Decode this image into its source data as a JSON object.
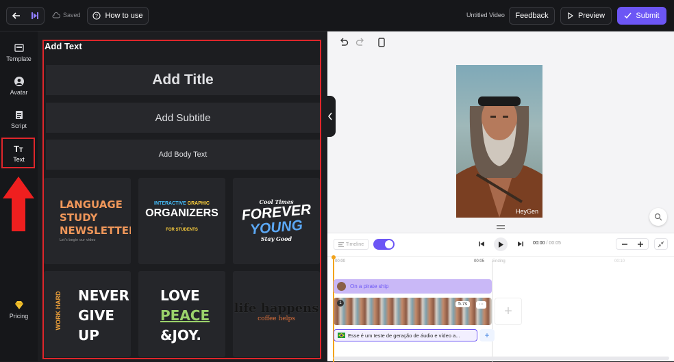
{
  "header": {
    "saved_label": "Saved",
    "how_to_use_label": "How to use",
    "project_title": "Untitled Video",
    "feedback_label": "Feedback",
    "preview_label": "Preview",
    "submit_label": "Submit",
    "submit_color": "#6c56f5"
  },
  "sidebar": {
    "items": [
      {
        "label": "Template",
        "icon": "template-icon"
      },
      {
        "label": "Avatar",
        "icon": "avatar-icon"
      },
      {
        "label": "Script",
        "icon": "script-icon"
      },
      {
        "label": "Text",
        "icon": "text-icon",
        "selected": true
      },
      {
        "label": "Pricing",
        "icon": "gem-icon"
      }
    ]
  },
  "panel": {
    "title": "Add Text",
    "add_title": "Add Title",
    "add_subtitle": "Add Subtitle",
    "add_body": "Add Body Text",
    "tiles": [
      {
        "lines": [
          "LANGUAGE",
          "STUDY",
          "NEWSLETTER"
        ],
        "sub": "Let's begin our video"
      },
      {
        "top": [
          "INTERACTIVE",
          "GRAPHIC"
        ],
        "main": "ORGANIZERS",
        "dash": "-",
        "bottom": "FOR STUDENTS"
      },
      {
        "top": "Cool Times",
        "main1": "FOREVER",
        "main2": "YOUNG",
        "bottom": "Stay Good"
      },
      {
        "side": "WORK HARD",
        "lines": [
          "NEVER",
          "GIVE",
          "UP"
        ]
      },
      {
        "line1": "LOVE",
        "line2": "PEACE",
        "line3": "&JOY."
      },
      {
        "main": "life happens",
        "sub": "coffee helps"
      }
    ]
  },
  "preview": {
    "watermark": "HeyGen"
  },
  "timeline": {
    "timeline_label": "Timeline",
    "time_current": "00:00",
    "time_total": "00:05",
    "ruler": [
      "00:00",
      "00:05",
      "00:10"
    ],
    "ending_label": "Ending",
    "scene_label": "On a pirate ship",
    "clip_badge": "1",
    "clip_duration": "5.7s",
    "clip_more": "···",
    "audio_text": "Esse é um teste de geração de áudio e vídeo a...",
    "add_symbol": "+"
  },
  "colors": {
    "accent": "#6c56f5",
    "highlight_red": "#e0262b",
    "scene_purple": "#c9b8f7"
  }
}
